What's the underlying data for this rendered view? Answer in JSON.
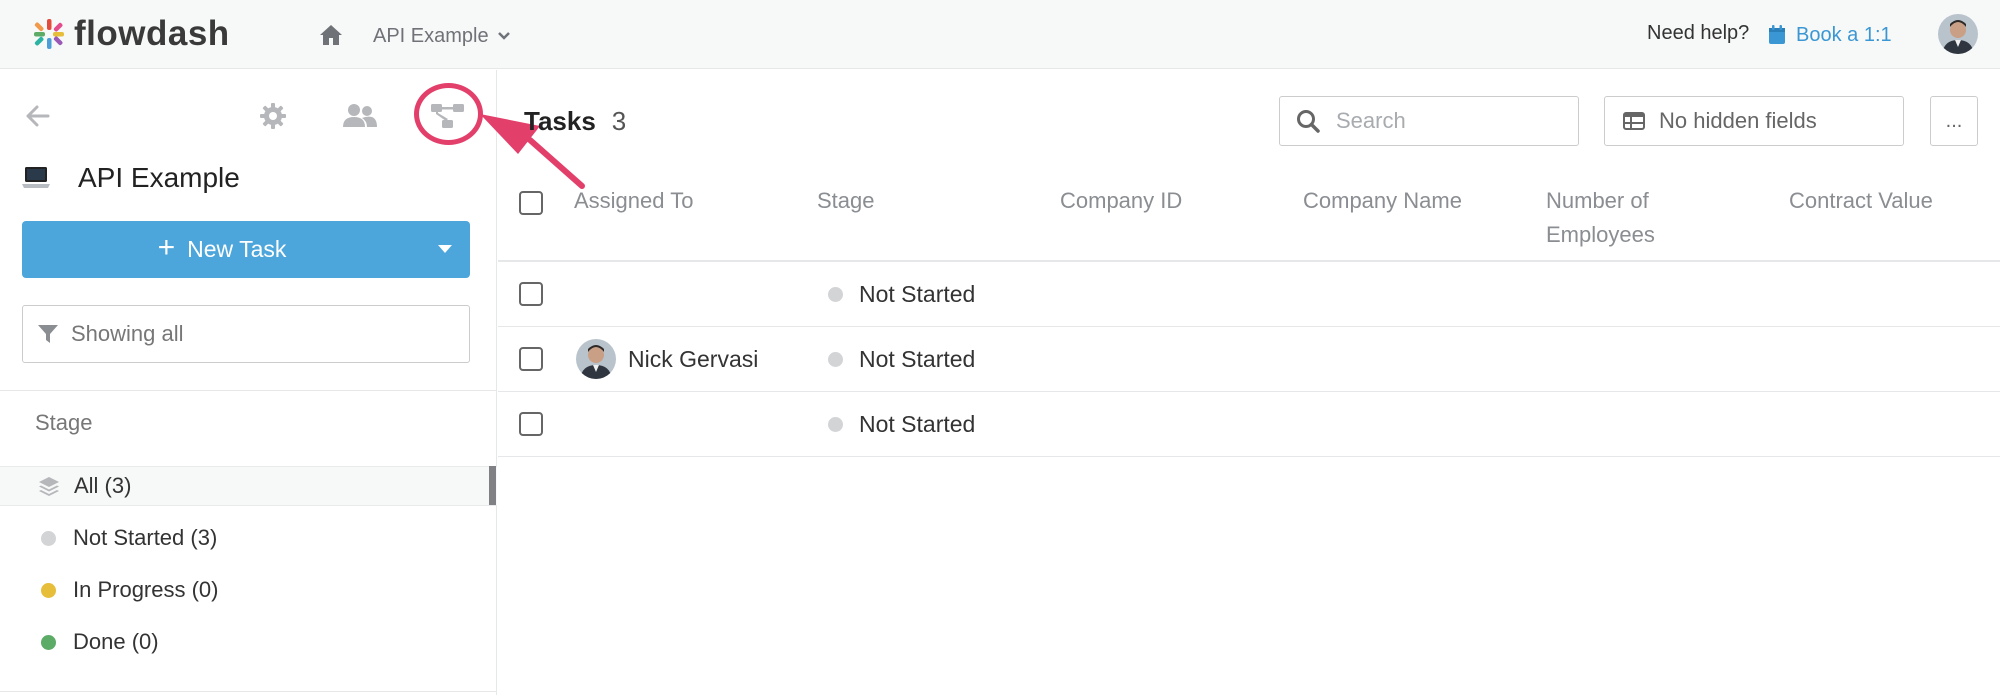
{
  "brand": {
    "name": "flowdash"
  },
  "header": {
    "app_name": "API Example",
    "help_label": "Need help?",
    "book_label": "Book a 1:1"
  },
  "sidebar": {
    "app_title": "API Example",
    "new_task_label": "New Task",
    "filter_label": "Showing all",
    "stage_header": "Stage",
    "stages": [
      {
        "label": "All (3)",
        "active": true
      },
      {
        "label": "Not Started (3)",
        "color": "#d3d4d6"
      },
      {
        "label": "In Progress (0)",
        "color": "#e6be3a"
      },
      {
        "label": "Done (0)",
        "color": "#5cab67"
      }
    ]
  },
  "main": {
    "title": "Tasks",
    "count": "3",
    "search_placeholder": "Search",
    "hidden_fields_label": "No hidden fields",
    "more_label": "...",
    "columns": [
      "Assigned To",
      "Stage",
      "Company ID",
      "Company Name",
      "Number of Employees",
      "Contract Value"
    ],
    "rows": [
      {
        "assigned_to": "",
        "stage": "Not Started"
      },
      {
        "assigned_to": "Nick Gervasi",
        "stage": "Not Started"
      },
      {
        "assigned_to": "",
        "stage": "Not Started"
      }
    ]
  },
  "colors": {
    "accent": "#4ca5db",
    "link": "#3b97d3",
    "highlight": "#e33f6b",
    "not_started": "#d3d4d6"
  },
  "icons": [
    "home-icon",
    "chevron-down-icon",
    "calendar-icon",
    "back-arrow-icon",
    "gear-icon",
    "users-icon",
    "workflow-icon",
    "laptop-icon",
    "plus-icon",
    "filter-icon",
    "layers-icon",
    "search-icon",
    "table-icon"
  ]
}
